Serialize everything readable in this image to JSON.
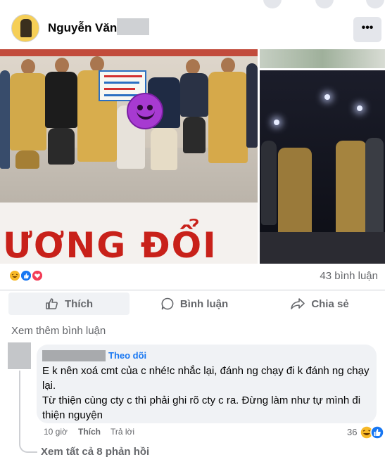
{
  "header": {
    "author_name": "Nguyễn Văn",
    "more_label": "•••"
  },
  "post_image": {
    "sign_text": "ƯƠNG   ĐỔI"
  },
  "reactions": {
    "icons": [
      "haha-emoji",
      "like-icon",
      "love-icon"
    ],
    "comment_count_label": "43 bình luận"
  },
  "actions": {
    "like_label": "Thích",
    "comment_label": "Bình luận",
    "share_label": "Chia sẻ"
  },
  "comments": {
    "view_more_label": "Xem thêm bình luận",
    "items": [
      {
        "follow_label": "Theo dõi",
        "text_lines": [
          "E k nên xoá cmt của c nhé!c nhắc lại, đánh ng chạy đi k đánh ng chạy lại.",
          "Từ thiện cùng cty c thì phải ghi rõ cty c ra. Đừng làm như tự mình đi thiện nguyện"
        ],
        "time": "10 giờ",
        "like_label": "Thích",
        "reply_label": "Trả lời",
        "reaction_count": "36"
      }
    ],
    "see_replies_label": "Xem tất cả 8 phản hồi"
  },
  "colors": {
    "accent_blue": "#1877f2",
    "muted_text": "#65676b",
    "bubble_bg": "#f0f2f5",
    "sign_red": "#c8211a"
  }
}
